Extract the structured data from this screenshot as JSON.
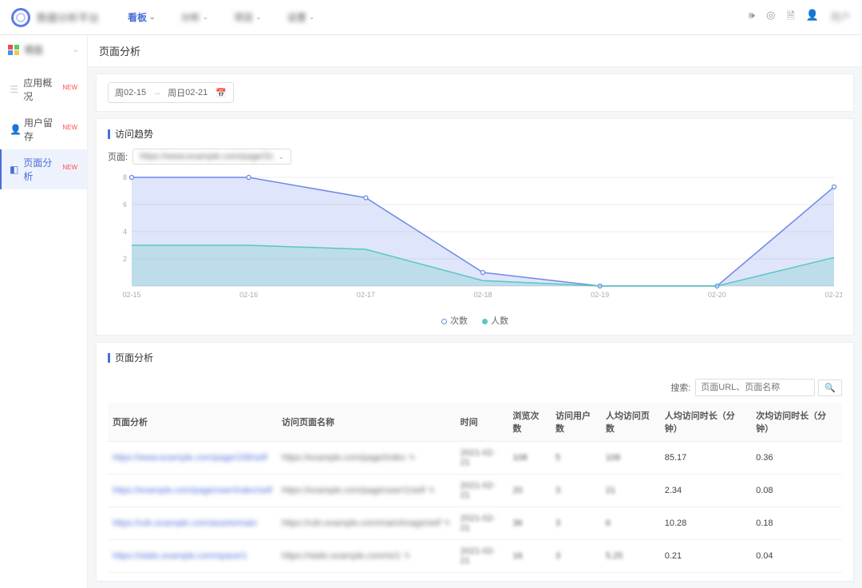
{
  "header": {
    "brand": "数据分析平台",
    "nav": [
      {
        "label": "看板",
        "active": true
      },
      {
        "label": "分析",
        "active": false,
        "blur": true
      },
      {
        "label": "项目",
        "active": false,
        "blur": true
      },
      {
        "label": "设置",
        "active": false,
        "blur": true
      }
    ],
    "user_text": "用户"
  },
  "sidebar": {
    "workspace": "项目",
    "items": [
      {
        "ico": "☰",
        "label": "应用概况",
        "new": "NEW"
      },
      {
        "ico": "👤",
        "label": "用户留存",
        "new": "NEW"
      },
      {
        "ico": "◧",
        "label": "页面分析",
        "new": "NEW",
        "active": true
      }
    ]
  },
  "page": {
    "title": "页面分析",
    "date_range": {
      "from_prefix": "周 ",
      "from": "02-15",
      "to_prefix": "周日 ",
      "to": "02-21"
    },
    "trend_title": "访问趋势",
    "page_label": "页面:",
    "page_value": "https://www.example.com/page/31",
    "legend": {
      "visits": "次数",
      "users": "人数"
    },
    "table_title": "页面分析",
    "search_label": "搜索:",
    "search_placeholder": "页面URL、页面名称",
    "columns": [
      "页面分析",
      "访问页面名称",
      "时间",
      "浏览次数",
      "访问用户数",
      "人均访问页数",
      "人均访问时长（分钟）",
      "次均访问时长（分钟）"
    ],
    "rows": [
      {
        "url": "https://www.example.com/page/158/self",
        "name": "https://example.com/page/index",
        "time": "2021-02-21",
        "c1": "108",
        "c2": "5",
        "c3": "108",
        "c4": "85.17",
        "c5": "0.36"
      },
      {
        "url": "https://example.com/page/user/index/self",
        "name": "https://example.com/page/user/1/self",
        "time": "2021-02-21",
        "c1": "20",
        "c2": "3",
        "c3": "21",
        "c4": "2.34",
        "c5": "0.08"
      },
      {
        "url": "https://cdn.example.com/assets/main",
        "name": "https://cdn.example.com/main/image/self",
        "time": "2021-02-21",
        "c1": "36",
        "c2": "3",
        "c3": "6",
        "c4": "10.28",
        "c5": "0.18"
      },
      {
        "url": "https://static.example.com/space/1",
        "name": "https://static.example.com/re/1",
        "time": "2021-02-21",
        "c1": "16",
        "c2": "3",
        "c3": "5.25",
        "c4": "0.21",
        "c5": "0.04"
      }
    ]
  },
  "chart_data": {
    "type": "area",
    "x": [
      "02-15",
      "02-16",
      "02-17",
      "02-18",
      "02-19",
      "02-20",
      "02-21"
    ],
    "series": [
      {
        "name": "次数",
        "color": "#6c8ae6",
        "values": [
          8,
          8,
          6.5,
          1.0,
          0,
          0,
          7.3
        ]
      },
      {
        "name": "人数",
        "color": "#58c7c0",
        "values": [
          3,
          3,
          2.7,
          0.4,
          0,
          0,
          2.1
        ]
      }
    ],
    "ylim": [
      0,
      8
    ],
    "yticks": [
      2,
      4,
      6,
      8
    ]
  }
}
